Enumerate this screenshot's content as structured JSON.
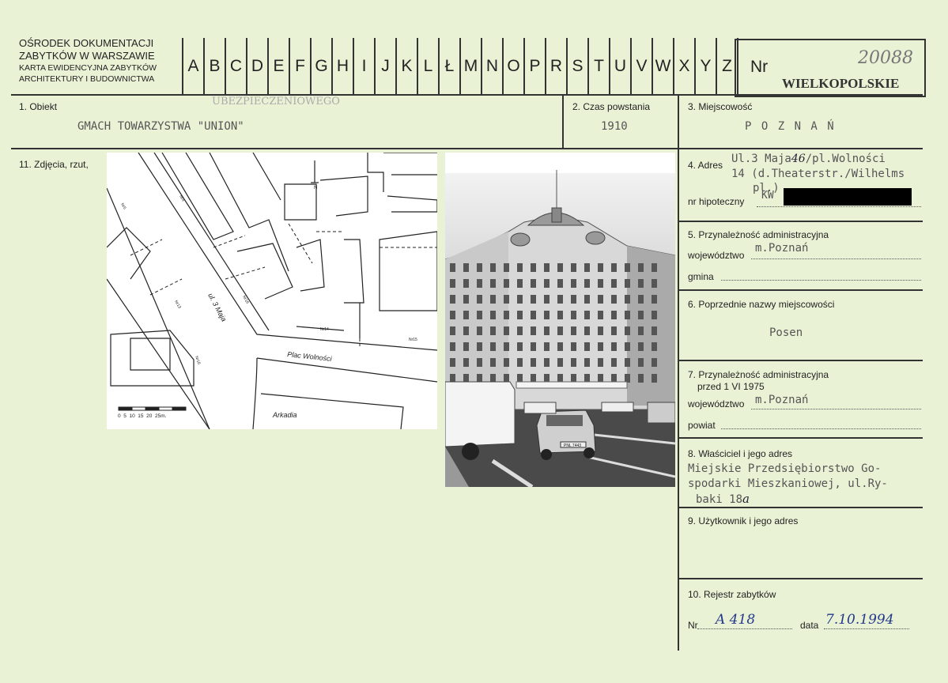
{
  "header": {
    "institution_line1": "OŚRODEK DOKUMENTACJI",
    "institution_line2": "ZABYTKÓW W WARSZAWIE",
    "card_line1": "KARTA EWIDENCYJNA ZABYTKÓW",
    "card_line2": "ARCHITEKTURY I BUDOWNICTWA",
    "letters": [
      "A",
      "B",
      "C",
      "D",
      "E",
      "F",
      "G",
      "H",
      "I",
      "J",
      "K",
      "L",
      "Ł",
      "M",
      "N",
      "O",
      "P",
      "R",
      "S",
      "T",
      "U",
      "V",
      "W",
      "X",
      "Y",
      "Z"
    ],
    "nr_label": "Nr",
    "nr_value": "20088",
    "region": "WIELKOPOLSKIE"
  },
  "obiekt": {
    "label": "1. Obiekt",
    "stamp": "UBEZPIECZENIOWEGO",
    "value": "GMACH TOWARZYSTWA \"UNION\""
  },
  "czas": {
    "label": "2. Czas powstania",
    "value": "1910"
  },
  "miejscowosc": {
    "label": "3. Miejscowość",
    "value": "P O Z N A Ń"
  },
  "zdjecia": {
    "label": "11. Zdjęcia, rzut,"
  },
  "map": {
    "street1": "ul. 3 Maja",
    "square": "Plac Wolności",
    "building": "Arkadia",
    "scale_numbers": "0  5  10  15  20  25m.",
    "n_marker": "N",
    "nr14": "Nr14",
    "nr15": "Nr15",
    "nr16": "Nr16",
    "nr13": "Nr13",
    "nr5": "Nr5",
    "nr_a": "Nr4",
    "nr_b": "Nr16"
  },
  "photo": {
    "plate": "PNL 7443"
  },
  "adres": {
    "label": "4. Adres",
    "line1": "Ul.3 Maja",
    "num_hand": "46",
    "line1b": "/pl.Wolności",
    "line2": "14 (d.Theaterstr./Wilhelms",
    "line3": "pl.)",
    "hipoteczny_label": "nr hipoteczny",
    "kw": "KW"
  },
  "przynaleznosc": {
    "label": "5. Przynależność administracyjna",
    "wojewodztwo_label": "województwo",
    "wojewodztwo_value": "m.Poznań",
    "gmina_label": "gmina"
  },
  "poprzednie": {
    "label": "6. Poprzednie nazwy miejscowości",
    "value": "Posen"
  },
  "przed1975": {
    "label1": "7. Przynależność administracyjna",
    "label2": "przed 1 VI 1975",
    "wojewodztwo_label": "województwo",
    "wojewodztwo_value": "m.Poznań",
    "powiat_label": "powiat"
  },
  "wlasciciel": {
    "label": "8. Właściciel i jego adres",
    "line1": "Miejskie Przedsiębiorstwo Go-",
    "line2": "spodarki Mieszkaniowej, ul.Ry-",
    "line3": "baki 18",
    "hand": "a"
  },
  "uzytkownik": {
    "label": "9. Użytkownik i jego adres"
  },
  "rejestr": {
    "label": "10. Rejestr zabytków",
    "nr_label": "Nr",
    "nr_value": "A 418",
    "data_label": "data",
    "data_value": "7.10.1994"
  }
}
